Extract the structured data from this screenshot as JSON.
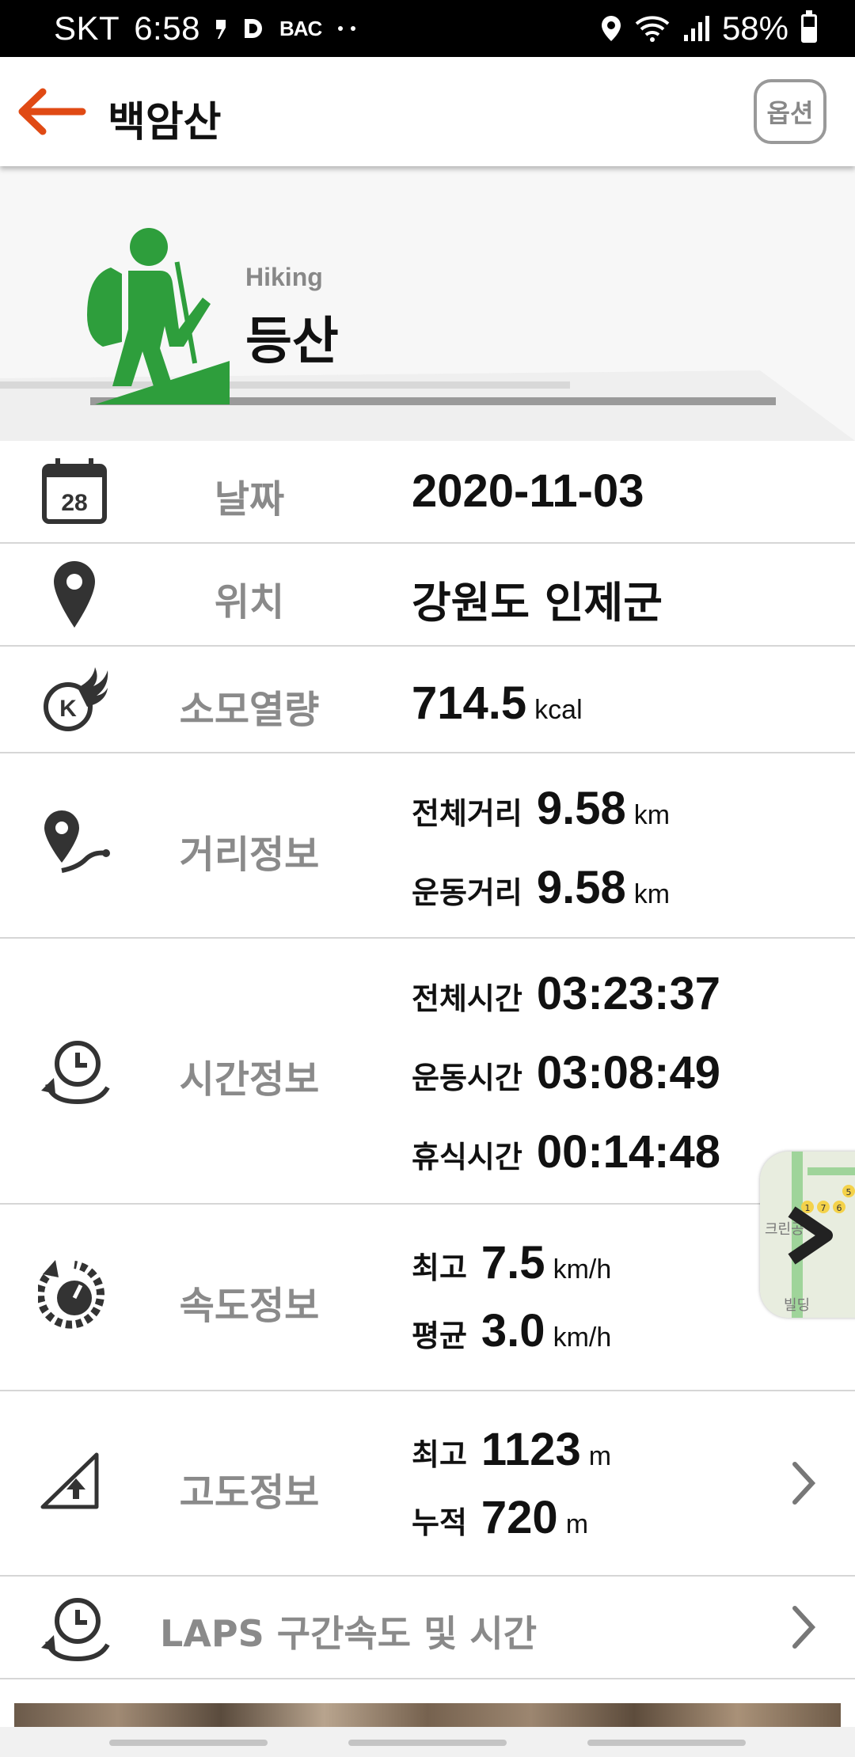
{
  "status_bar": {
    "carrier": "SKT",
    "time": "6:58",
    "left_icons": [
      "notification-icon",
      "d-app-icon",
      "bac-app-icon",
      "more-dots-icon"
    ],
    "bac_text": "BAC",
    "battery": "58%",
    "battery_level": 0.58,
    "right_icons": [
      "location-icon",
      "wifi-icon",
      "signal-icon",
      "battery-icon"
    ]
  },
  "header": {
    "title": "백암산",
    "option_label": "옵션",
    "accent_color": "#e04a14"
  },
  "hero": {
    "subtitle": "Hiking",
    "title": "등산",
    "icon_color": "#2e9e3c"
  },
  "rows": {
    "date": {
      "label": "날짜",
      "value": "2020-11-03",
      "calendar_day": "28"
    },
    "location": {
      "label": "위치",
      "value": "강원도 인제군"
    },
    "calories": {
      "label": "소모열량",
      "value": "714.5",
      "unit": "kcal",
      "badge": "K"
    },
    "distance": {
      "label": "거리정보",
      "lines": [
        {
          "key": "전체거리",
          "value": "9.58",
          "unit": "km"
        },
        {
          "key": "운동거리",
          "value": "9.58",
          "unit": "km"
        }
      ]
    },
    "time": {
      "label": "시간정보",
      "lines": [
        {
          "key": "전체시간",
          "value": "03:23:37"
        },
        {
          "key": "운동시간",
          "value": "03:08:49"
        },
        {
          "key": "휴식시간",
          "value": "00:14:48"
        }
      ]
    },
    "speed": {
      "label": "속도정보",
      "lines": [
        {
          "key": "최고",
          "value": "7.5",
          "unit": "km/h"
        },
        {
          "key": "평균",
          "value": "3.0",
          "unit": "km/h"
        }
      ]
    },
    "altitude": {
      "label": "고도정보",
      "lines": [
        {
          "key": "최고",
          "value": "1123",
          "unit": "m"
        },
        {
          "key": "누적",
          "value": "720",
          "unit": "m"
        }
      ]
    },
    "laps": {
      "label": "LAPS 구간속도 및 시간"
    }
  },
  "map_thumb": {
    "texts": [
      "크린공",
      "빌딩",
      "5",
      "7",
      "6",
      "1"
    ]
  }
}
